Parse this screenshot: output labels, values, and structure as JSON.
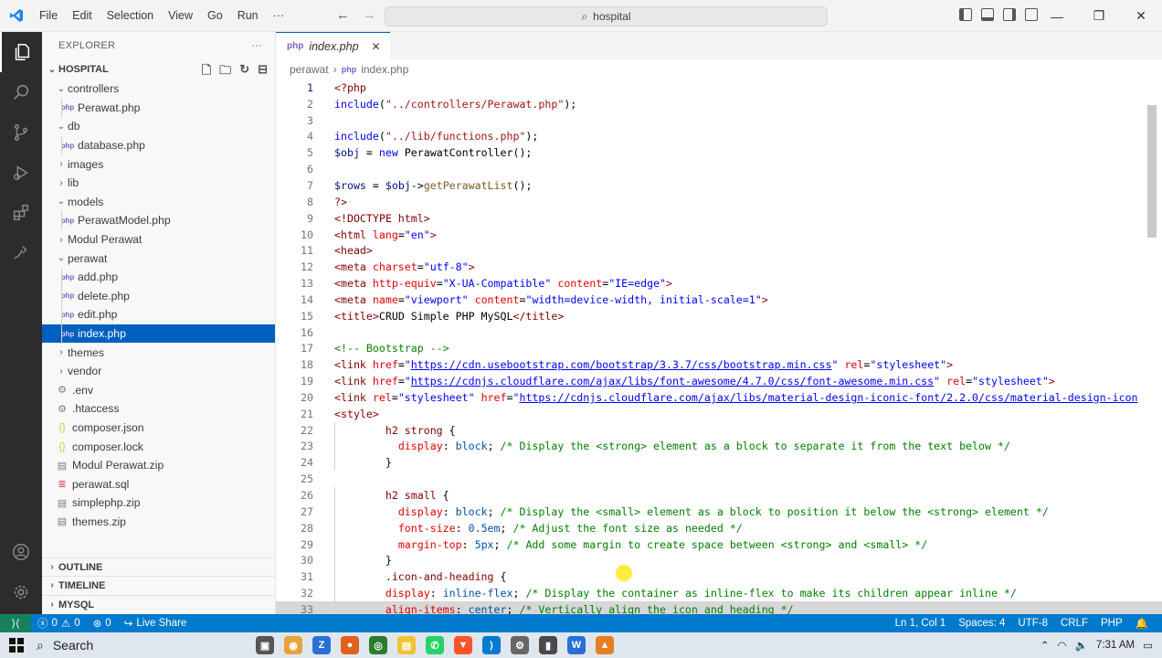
{
  "titlebar": {
    "menu": [
      "File",
      "Edit",
      "Selection",
      "View",
      "Go",
      "Run",
      "···"
    ],
    "search": "hospital"
  },
  "sidebar": {
    "title": "EXPLORER",
    "more": "···",
    "root": "HOSPITAL",
    "tree": [
      {
        "label": "controllers",
        "type": "folder-open",
        "depth": 1
      },
      {
        "label": "Perawat.php",
        "type": "php",
        "depth": 2
      },
      {
        "label": "db",
        "type": "folder-open",
        "depth": 1
      },
      {
        "label": "database.php",
        "type": "php",
        "depth": 2
      },
      {
        "label": "images",
        "type": "folder",
        "depth": 1
      },
      {
        "label": "lib",
        "type": "folder",
        "depth": 1
      },
      {
        "label": "models",
        "type": "folder-open",
        "depth": 1
      },
      {
        "label": "PerawatModel.php",
        "type": "php",
        "depth": 2
      },
      {
        "label": "Modul Perawat",
        "type": "folder",
        "depth": 1
      },
      {
        "label": "perawat",
        "type": "folder-open",
        "depth": 1
      },
      {
        "label": "add.php",
        "type": "php",
        "depth": 2
      },
      {
        "label": "delete.php",
        "type": "php",
        "depth": 2
      },
      {
        "label": "edit.php",
        "type": "php",
        "depth": 2
      },
      {
        "label": "index.php",
        "type": "php",
        "depth": 2,
        "selected": true
      },
      {
        "label": "themes",
        "type": "folder",
        "depth": 1
      },
      {
        "label": "vendor",
        "type": "folder",
        "depth": 1
      },
      {
        "label": ".env",
        "type": "gear",
        "depth": 1
      },
      {
        "label": ".htaccess",
        "type": "gear",
        "depth": 1
      },
      {
        "label": "composer.json",
        "type": "json",
        "depth": 1
      },
      {
        "label": "composer.lock",
        "type": "json",
        "depth": 1
      },
      {
        "label": "Modul Perawat.zip",
        "type": "zip",
        "depth": 1
      },
      {
        "label": "perawat.sql",
        "type": "sql",
        "depth": 1
      },
      {
        "label": "simplephp.zip",
        "type": "zip",
        "depth": 1
      },
      {
        "label": "themes.zip",
        "type": "zip",
        "depth": 1
      }
    ],
    "sections": [
      "OUTLINE",
      "TIMELINE",
      "MYSQL"
    ]
  },
  "editor": {
    "tab": "index.php",
    "breadcrumb": [
      "perawat",
      "index.php"
    ]
  },
  "code_lines": [
    {
      "n": "1",
      "html": "<span class='php'>&lt;?php</span>"
    },
    {
      "n": "2",
      "html": "<span class='kw'>include</span>(<span class='str'>\"../controllers/Perawat.php\"</span>);"
    },
    {
      "n": "3",
      "html": ""
    },
    {
      "n": "4",
      "html": "<span class='kw'>include</span>(<span class='str'>\"../lib/functions.php\"</span>);"
    },
    {
      "n": "5",
      "html": "<span class='var'>$obj</span> = <span class='kw'>new</span> PerawatController();"
    },
    {
      "n": "6",
      "html": ""
    },
    {
      "n": "7",
      "html": "<span class='var'>$rows</span> = <span class='var'>$obj</span>-&gt;<span class='fn'>getPerawatList</span>();"
    },
    {
      "n": "8",
      "html": "<span class='php'>?&gt;</span>"
    },
    {
      "n": "9",
      "html": "<span class='tag'>&lt;!DOCTYPE html&gt;</span>"
    },
    {
      "n": "10",
      "html": "<span class='tag'>&lt;html</span> <span class='attr'>lang</span>=<span class='kw'>\"en\"</span><span class='tag'>&gt;</span>"
    },
    {
      "n": "11",
      "html": "<span class='tag'>&lt;head&gt;</span>"
    },
    {
      "n": "12",
      "html": "<span class='tag'>&lt;meta</span> <span class='attr'>charset</span>=<span class='kw'>\"utf-8\"</span><span class='tag'>&gt;</span>"
    },
    {
      "n": "13",
      "html": "<span class='tag'>&lt;meta</span> <span class='attr'>http-equiv</span>=<span class='kw'>\"X-UA-Compatible\"</span> <span class='attr'>content</span>=<span class='kw'>\"IE=edge\"</span><span class='tag'>&gt;</span>"
    },
    {
      "n": "14",
      "html": "<span class='tag'>&lt;meta</span> <span class='attr'>name</span>=<span class='kw'>\"viewport\"</span> <span class='attr'>content</span>=<span class='kw'>\"width=device-width, initial-scale=1\"</span><span class='tag'>&gt;</span>"
    },
    {
      "n": "15",
      "html": "<span class='tag'>&lt;title&gt;</span>CRUD Simple PHP MySQL<span class='tag'>&lt;/title&gt;</span>"
    },
    {
      "n": "16",
      "html": ""
    },
    {
      "n": "17",
      "html": "<span class='cmt'>&lt;!-- Bootstrap --&gt;</span>"
    },
    {
      "n": "18",
      "html": "<span class='tag'>&lt;link</span> <span class='attr'>href</span>=<span class='kw'>\"<span class='url'>https://cdn.usebootstrap.com/bootstrap/3.3.7/css/bootstrap.min.css</span>\"</span> <span class='attr'>rel</span>=<span class='kw'>\"stylesheet\"</span><span class='tag'>&gt;</span>"
    },
    {
      "n": "19",
      "html": "<span class='tag'>&lt;link</span> <span class='attr'>href</span>=<span class='kw'>\"<span class='url'>https://cdnjs.cloudflare.com/ajax/libs/font-awesome/4.7.0/css/font-awesome.min.css</span>\"</span> <span class='attr'>rel</span>=<span class='kw'>\"stylesheet\"</span><span class='tag'>&gt;</span>"
    },
    {
      "n": "20",
      "html": "<span class='tag'>&lt;link</span> <span class='attr'>rel</span>=<span class='kw'>\"stylesheet\"</span> <span class='attr'>href</span>=<span class='kw'>\"<span class='url'>https://cdnjs.cloudflare.com/ajax/libs/material-design-iconic-font/2.2.0/css/material-design-icon</span></span>"
    },
    {
      "n": "21",
      "html": "<span class='tag'>&lt;style&gt;</span>"
    },
    {
      "n": "22",
      "html": "        <span class='sel'>h2 strong</span> {"
    },
    {
      "n": "23",
      "html": "          <span class='prop'>display</span>: <span class='val'>block</span>; <span class='cmt'>/* Display the &lt;strong&gt; element as a block to separate it from the text below */</span>"
    },
    {
      "n": "24",
      "html": "        }"
    },
    {
      "n": "25",
      "html": ""
    },
    {
      "n": "26",
      "html": "        <span class='sel'>h2 small</span> {"
    },
    {
      "n": "27",
      "html": "          <span class='prop'>display</span>: <span class='val'>block</span>; <span class='cmt'>/* Display the &lt;small&gt; element as a block to position it below the &lt;strong&gt; element */</span>"
    },
    {
      "n": "28",
      "html": "          <span class='prop'>font-size</span>: <span class='val'>0.5em</span>; <span class='cmt'>/* Adjust the font size as needed */</span>"
    },
    {
      "n": "29",
      "html": "          <span class='prop'>margin-top</span>: <span class='val'>5px</span>; <span class='cmt'>/* Add some margin to create space between &lt;strong&gt; and &lt;small&gt; */</span>"
    },
    {
      "n": "30",
      "html": "        }"
    },
    {
      "n": "31",
      "html": "        <span class='sel'>.icon-and-heading</span> {"
    },
    {
      "n": "32",
      "html": "        <span class='prop'>display</span>: <span class='val'>inline-flex</span>; <span class='cmt'>/* Display the container as inline-flex to make its children appear inline */</span>"
    },
    {
      "n": "33",
      "html": "        <span class='prop'>align-items</span>: <span class='val'>center</span>; <span class='cmt'>/* Vertically align the icon and heading */</span>",
      "hl": true
    }
  ],
  "statusbar": {
    "errors": "0",
    "warnings": "0",
    "ports": "0",
    "liveshare": "Live Share",
    "position": "Ln 1, Col 1",
    "spaces": "Spaces: 4",
    "encoding": "UTF-8",
    "eol": "CRLF",
    "language": "PHP"
  },
  "taskbar": {
    "search": "Search",
    "time": "7:31 AM"
  },
  "colors": {
    "accent": "#007acc",
    "selection": "#0060c0",
    "activitybar": "#2c2c2c",
    "php_icon": "#7a5fc0"
  }
}
